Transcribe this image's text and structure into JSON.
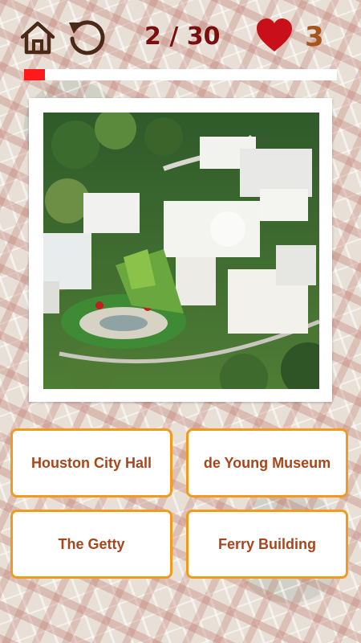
{
  "header": {
    "home_icon": "home-icon",
    "restart_icon": "restart-icon",
    "counter_text": "2 / 30",
    "lives_icon": "heart-icon",
    "lives": "3"
  },
  "progress": {
    "fraction": 0.0667,
    "fill_color": "#ff1a1a"
  },
  "question": {
    "image": "aerial-photo-getty-center"
  },
  "answers": [
    {
      "label": "Houston City Hall"
    },
    {
      "label": "de Young Museum"
    },
    {
      "label": "The Getty"
    },
    {
      "label": "Ferry Building"
    }
  ],
  "colors": {
    "counter": "#7a0f10",
    "lives": "#a6561c",
    "answer_border": "#f29a1f",
    "answer_text": "#a8451b",
    "heart": "#c8101a"
  }
}
